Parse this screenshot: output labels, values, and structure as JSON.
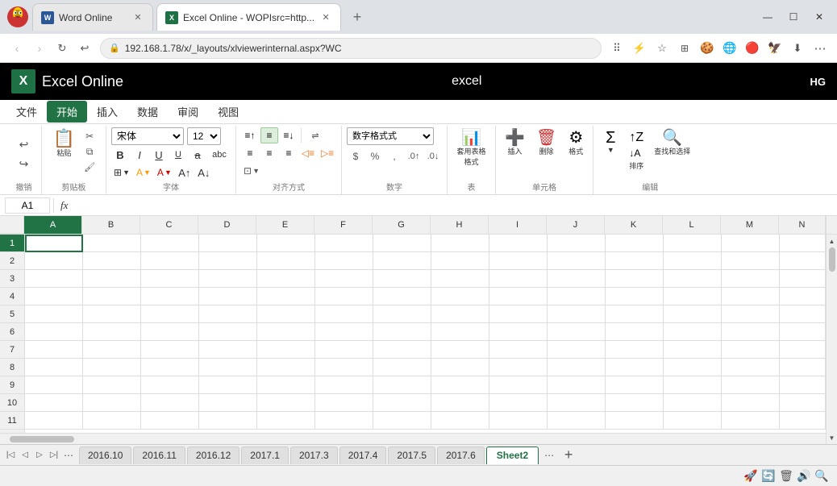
{
  "browser": {
    "tabs": [
      {
        "id": "word",
        "icon": "W",
        "icon_type": "word",
        "title": "Word Online",
        "active": false
      },
      {
        "id": "excel",
        "icon": "X",
        "icon_type": "excel",
        "title": "Excel Online - WOPIsrc=http...",
        "active": true
      }
    ],
    "address": "192.168.1.78/x/_layouts/xlviewerinternal.aspx?WC",
    "window_buttons": [
      "⊡",
      "—",
      "☐",
      "✕"
    ]
  },
  "app": {
    "logo_letter": "X",
    "title": "Excel Online",
    "center_text": "excel",
    "user": "HG"
  },
  "menu": {
    "items": [
      "文件",
      "开始",
      "插入",
      "数据",
      "审阅",
      "视图"
    ],
    "active_index": 1
  },
  "ribbon": {
    "groups": [
      {
        "label": "撤销",
        "buttons": []
      },
      {
        "label": "剪贴板",
        "buttons": []
      },
      {
        "label": "字体",
        "buttons": []
      },
      {
        "label": "对齐方式",
        "buttons": []
      },
      {
        "label": "数字",
        "buttons": []
      },
      {
        "label": "表",
        "buttons": []
      },
      {
        "label": "插入",
        "buttons": []
      },
      {
        "label": "删除",
        "buttons": []
      },
      {
        "label": "单元格",
        "buttons": []
      },
      {
        "label": "编辑",
        "buttons": []
      }
    ],
    "font_name": "宋体",
    "font_size": "12",
    "number_format": "数字格式式"
  },
  "formula_bar": {
    "cell_ref": "A1",
    "fx_label": "fx",
    "formula_value": ""
  },
  "grid": {
    "selected_cell": "A1",
    "columns": [
      "A",
      "B",
      "C",
      "D",
      "E",
      "F",
      "G",
      "H",
      "I",
      "J",
      "K",
      "L",
      "M",
      "N"
    ],
    "rows": [
      1,
      2,
      3,
      4,
      5,
      6,
      7,
      8,
      9,
      10,
      11
    ]
  },
  "sheet_tabs": {
    "tabs": [
      "2016.10",
      "2016.11",
      "2016.12",
      "2017.1",
      "2017.3",
      "2017.4",
      "2017.5",
      "2017.6",
      "Sheet2"
    ],
    "active_tab": "Sheet2"
  },
  "status_bar": {
    "icons": [
      "🚀",
      "🔄",
      "🗑",
      "🔊",
      "🔍"
    ]
  }
}
